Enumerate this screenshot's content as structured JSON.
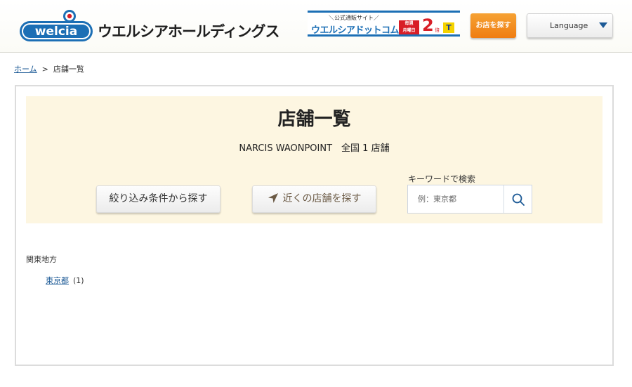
{
  "header": {
    "logo_text": "welcia",
    "corp_name": "ウエルシアホールディングス",
    "banner": {
      "top_text": "＼公式通販サイト／",
      "main_text": "ウエルシアドットコム",
      "tag_text": "毎週\n月曜日",
      "big_number": "2",
      "big_suffix": "倍",
      "t_mark": "T"
    },
    "find_store_label": "お店を探す",
    "language_label": "Language"
  },
  "breadcrumb": {
    "home": "ホーム",
    "separator": ">",
    "current": "店舗一覧"
  },
  "main": {
    "title": "店舗一覧",
    "subtitle": "NARCIS WAONPOINT　全国 1 店舗",
    "filter_button": "絞り込み条件から探す",
    "nearby_button": "近くの店舗を探す",
    "keyword_label": "キーワードで検索",
    "keyword_placeholder": "例：東京都",
    "keyword_value": ""
  },
  "regions": [
    {
      "name": "関東地方",
      "prefectures": [
        {
          "name": "東京都",
          "count": "(1)"
        }
      ]
    }
  ],
  "colors": {
    "brand_blue": "#1c5a96",
    "accent_orange": "#ef7d12",
    "panel_bg": "#fdf6e1"
  }
}
